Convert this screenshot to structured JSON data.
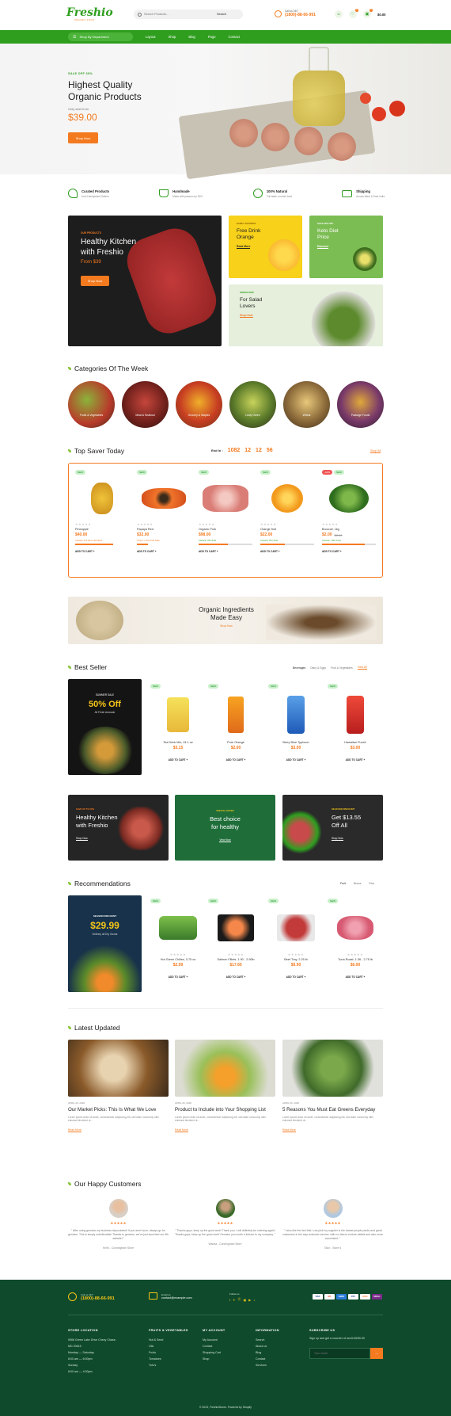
{
  "header": {
    "logo": "Freshio",
    "logo_tagline": "ORGANIC FOOD",
    "search_placeholder": "Search Products...",
    "search_button": "Search",
    "call_label": "Call us 24/7",
    "phone": "(1800)-88-66-991",
    "cart_total": "$0.00",
    "wishlist_count": "0",
    "cart_count": "0"
  },
  "nav": {
    "department": "Shop By Department",
    "items": [
      "Layout",
      "Shop",
      "Blog",
      "Page",
      "Contact"
    ]
  },
  "hero": {
    "kicker": "SALE OFF 30%",
    "title_line1": "Highest Quality",
    "title_line2": "Organic Products",
    "start_from": "Only start from",
    "price": "$39.00",
    "button": "Shop Now"
  },
  "features": [
    {
      "title": "Curated Products",
      "desc": "from Handpicked Sellers",
      "icon": "hand-leaf-icon"
    },
    {
      "title": "Handmade",
      "desc": "Made with passion by 300+",
      "icon": "basket-icon"
    },
    {
      "title": "100% Natural",
      "desc": "Full taste, nourish food",
      "icon": "natural-icon"
    },
    {
      "title": "Shipping",
      "desc": "Across West & East India",
      "icon": "truck-icon"
    }
  ],
  "promos": {
    "big": {
      "kicker": "OUR PRODUCTS",
      "title_line1": "Healthy Kitchen",
      "title_line2": "with Freshio",
      "from": "From $39",
      "button": "Shop Now"
    },
    "orange": {
      "kicker": "FAMILY FAVORITE",
      "title_line1": "Free Drink",
      "title_line2": "Orange",
      "button": "Read More"
    },
    "keto": {
      "kicker": "SALE 30% OFF",
      "title_line1": "Keto Diet",
      "title_line2": "Price",
      "button": "Discover"
    },
    "salad": {
      "kicker": "ORDER NOW",
      "title_line1": "For Salad",
      "title_line2": "Lovers",
      "button": "Shop Now"
    }
  },
  "categories": {
    "title": "Categories Of The Week",
    "items": [
      "Fruits & Vegetables",
      "Meat & Seafood",
      "Grocery & Staples",
      "Leafy Green",
      "Wheat",
      "Package Foods"
    ]
  },
  "top_saver": {
    "title": "Top Saver Today",
    "ends_label": "End In :",
    "countdown": [
      "1082",
      "12",
      "12",
      "56"
    ],
    "view_all": "Shop All",
    "products": [
      {
        "badges": [
          "NEW"
        ],
        "name": "Pineapple",
        "price": "$40.00",
        "old": "",
        "stock": "Instock, 8.3 kIns  Hundred"
      },
      {
        "badges": [
          "NEW"
        ],
        "name": "Papaya Red",
        "price": "$32.00",
        "old": "",
        "stock": "Only 1 Units Full Sale"
      },
      {
        "badges": [
          "NEW"
        ],
        "name": "Organic Pork",
        "price": "$98.00",
        "old": "",
        "stock": "Instock, 95 Units"
      },
      {
        "badges": [
          "NEW"
        ],
        "name": "Orange fruit",
        "price": "$22.00",
        "old": "",
        "stock": "Instock, 65 Units"
      },
      {
        "badges": [
          "-10%",
          "NEW"
        ],
        "name": "Broccoli, 1kg",
        "price": "$2.00",
        "old": "$3.00",
        "stock": "Instock, 100 Units"
      }
    ],
    "add_to_cart": "ADD TO CART +"
  },
  "organic_banner": {
    "title_line1": "Organic Ingredients",
    "title_line2": "Made Easy",
    "link": "Shop Now"
  },
  "best_seller": {
    "title": "Best Seller",
    "tabs": [
      "Beverages",
      "Dairy & Eggs",
      "Fruit & Vegetables",
      "View All"
    ],
    "promo": {
      "kicker": "SUMMER SALE",
      "discount": "50% Off",
      "sub": "All Fresh Avocado"
    },
    "products": [
      {
        "name": "Tea Drink Mix, 24.1 oz",
        "price": "$3.15"
      },
      {
        "name": "Pure Orange",
        "price": "$2.00"
      },
      {
        "name": "Berry Blue Typhoon",
        "price": "$3.00"
      },
      {
        "name": "Hawaiian Punch",
        "price": "$3.00"
      }
    ]
  },
  "banners3": [
    {
      "kicker": "SAVE UP TO 20%",
      "title_line1": "Healthy Kitchen",
      "title_line2": "with Freshio",
      "button": "Shop Now"
    },
    {
      "kicker": "SPECIAL OFFER",
      "title_line1": "Best choice",
      "title_line2": "for healthy",
      "button": "View Now"
    },
    {
      "kicker": "SEAFOOD DISCOUNT",
      "title_line1": "Get $13.55",
      "title_line2": "Off All",
      "button": "Shop Now"
    }
  ],
  "recommendations": {
    "title": "Recommendations",
    "tabs": [
      "Fruit",
      "Beans",
      "Rice"
    ],
    "promo": {
      "kicker": "SEASON DISCOUNT",
      "price": "$29.99",
      "sub": "Delivery all Dry Goods"
    },
    "products": [
      {
        "name": "Hot Green Chilies, 3.75 oz",
        "price": "$2.99"
      },
      {
        "name": "Salmon Fillets, 1.90 - 2.90lb",
        "price": "$17.60"
      },
      {
        "name": "Beef Tray, 2.25 lb",
        "price": "$9.90"
      },
      {
        "name": "Tuna Roast, 1.36 - 2.75 lb",
        "price": "$6.90"
      }
    ]
  },
  "latest": {
    "title": "Latest Updated",
    "posts": [
      {
        "date": "APRIL 26, 2020",
        "title": "Our Market Picks: This Is What We Love",
        "excerpt": "Lorem ipsum dolor sit amet, consectetuer adipiscing elit, sed diam nonummy nibh euismod tincidunt ut...",
        "link": "Read More"
      },
      {
        "date": "APRIL 26, 2020",
        "title": "Product to Include into Your Shopping List",
        "excerpt": "Lorem ipsum dolor sit amet, consectetuer adipiscing elit, sed diam nonummy nibh euismod tincidunt ut...",
        "link": "Read More"
      },
      {
        "date": "APRIL 26, 2020",
        "title": "5 Reasons You Must Eat Greens Everyday",
        "excerpt": "Lorem ipsum dolor sit amet, consectetuer adipiscing elit, sed diam nonummy nibh euismod tincidunt ut...",
        "link": "Read More"
      }
    ]
  },
  "testimonials": {
    "title": "Our Happy Customers",
    "items": [
      {
        "quote": "\" After using genuine my business skyrocketed! If you aren't sure, always go for genuine. This is simply unbelievable! Thanks to genuine, we've just launched our 5th website! \"",
        "author": "Keith - Cunningham Store"
      },
      {
        "quote": "\" Thanks guys, keep up the good work! Thank you, I will definitely be ordering again! Thanks guys, keep up the good work! Genuine you worth a fortune to my company. \"",
        "author": "Wanda - Cunningham Store"
      },
      {
        "quote": "\" I also like the fact that I can pick my supplier is the lowest people packs and great customers in the way customer service, with no idea to endure details and also more convenient. \"",
        "author": "Talor - Store 6"
      }
    ]
  },
  "footer": {
    "phone_label": "Call us 24/7",
    "phone": "(1800)-88-66-991",
    "email_label": "Email us",
    "email": "contact@example.com",
    "follow_label": "Follow us",
    "payments": [
      "VISA",
      "MC",
      "AMEX",
      "PAY",
      "DISC",
      "SKRILL"
    ],
    "columns": [
      {
        "title": "STORE LOCATION",
        "links": [
          "9066 Green Lake Drive Chevy Chase,",
          "MD 20815",
          "",
          "Monday — Saturday",
          "8:00 am — 6:00pm",
          "Sunday",
          "8:00 am — 4:00pm"
        ]
      },
      {
        "title": "FRUITS & VEGETABLES",
        "links": [
          "Nut & Seed",
          "Oils",
          "Fruits",
          "Tomatoes",
          "Tofu's"
        ]
      },
      {
        "title": "MY ACCOUNT",
        "links": [
          "My Account",
          "Contact",
          "Shopping Cart",
          "Shop"
        ]
      },
      {
        "title": "INFORMATION",
        "links": [
          "Search",
          "About us",
          "Blog",
          "Contact",
          "Services"
        ]
      }
    ],
    "newsletter_title": "SUBSCRIBE US",
    "newsletter_text": "Sign up and get a voucher of worth $250.00",
    "email_placeholder": "Your email",
    "copyright": "© 2023, FreshioStores. Powered by Shopify"
  }
}
